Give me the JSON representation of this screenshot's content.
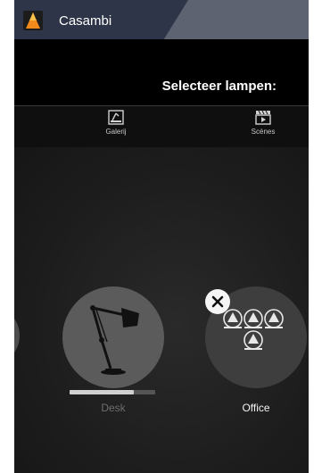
{
  "app": {
    "title": "Casambi",
    "logo_icon": "casambi-logo-icon"
  },
  "header": {
    "title": "Selecteer lampen:"
  },
  "tabs": [
    {
      "label": "Galerij",
      "icon": "gallery-icon"
    },
    {
      "label": "Scènes",
      "icon": "scenes-icon"
    }
  ],
  "lamps": [
    {
      "label": "Desk",
      "icon": "desk-lamp-icon",
      "dim_level": 0.75
    },
    {
      "label": "Office",
      "icon": "group-lamps-icon",
      "remove_icon": "close-icon"
    }
  ],
  "colors": {
    "tab_active": "#2f3548",
    "tab_inactive": "#5d6370",
    "logo_orange": "#f08a1c",
    "background": "#1a1a1a"
  }
}
